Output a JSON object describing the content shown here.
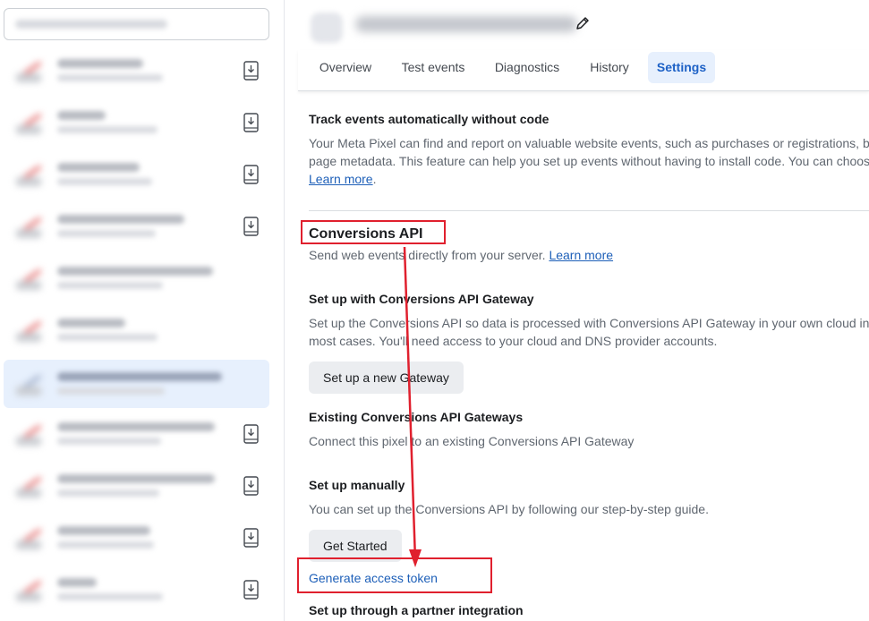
{
  "header": {
    "tabs": [
      {
        "label": "Overview"
      },
      {
        "label": "Test events"
      },
      {
        "label": "Diagnostics"
      },
      {
        "label": "History"
      },
      {
        "label": "Settings"
      }
    ]
  },
  "auto_events": {
    "title": "Track events automatically without code",
    "desc_line1": "Your Meta Pixel can find and report on valuable website events, such as purchases or registrations, ba",
    "desc_line2": "page metadata. This feature can help you set up events without having to install code. You can choos",
    "learn_more": "Learn more",
    "period": "."
  },
  "capi": {
    "title": "Conversions API",
    "desc": "Send web events directly from your server.",
    "learn_more": "Learn more"
  },
  "gateway": {
    "title": "Set up with Conversions API Gateway",
    "desc_line1": "Set up the Conversions API so data is processed with Conversions API Gateway in your own cloud inf",
    "desc_line2": "most cases. You'll need access to your cloud and DNS provider accounts.",
    "button": "Set up a new Gateway"
  },
  "existing": {
    "title": "Existing Conversions API Gateways",
    "desc": "Connect this pixel to an existing Conversions API Gateway"
  },
  "manual": {
    "title": "Set up manually",
    "desc": "You can set up the Conversions API by following our step-by-step guide.",
    "button": "Get Started",
    "token_link": "Generate access token"
  },
  "partner": {
    "title": "Set up through a partner integration"
  },
  "colors": {
    "accent": "#1d61c6",
    "link": "#1d5fb8",
    "annotation": "#e0202e"
  }
}
